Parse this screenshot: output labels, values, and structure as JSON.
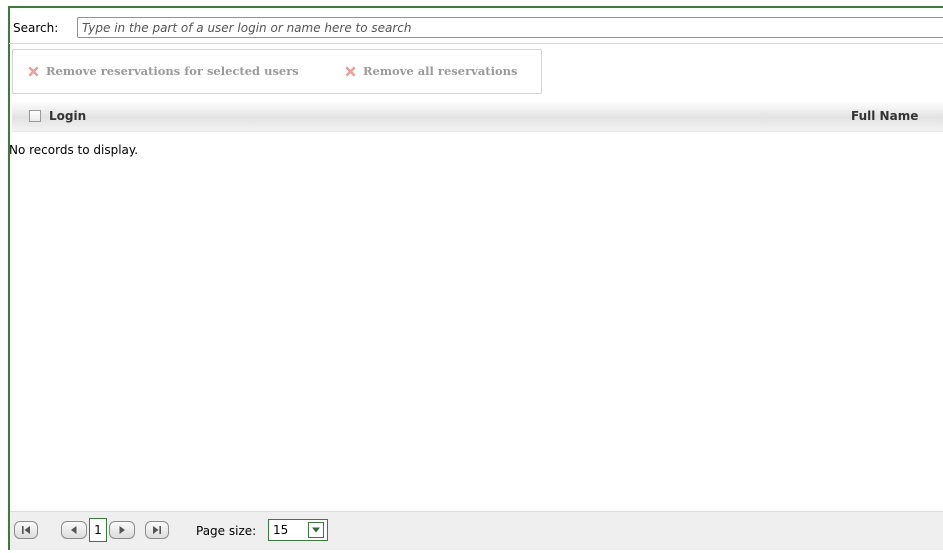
{
  "search": {
    "label": "Search:",
    "placeholder": "Type in the part of a user login or name here to search",
    "value": ""
  },
  "toolbar": {
    "remove_selected_label": "Remove reservations for selected users",
    "remove_all_label": "Remove all reservations",
    "icon": "x-icon",
    "disabled_color": "#9a9a9a",
    "icon_color": "#f0a0a0"
  },
  "grid": {
    "columns": [
      "Login",
      "Full Name"
    ],
    "empty_message": "No records to display.",
    "rows": []
  },
  "pager": {
    "first_icon": "first-page-icon",
    "prev_icon": "prev-page-icon",
    "current_page": "1",
    "next_icon": "next-page-icon",
    "last_icon": "last-page-icon",
    "page_size_label": "Page size:",
    "page_size_value": "15"
  },
  "colors": {
    "accent": "#3a7d3a"
  }
}
